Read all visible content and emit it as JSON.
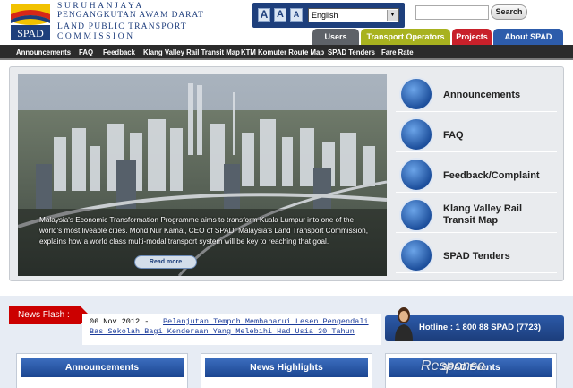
{
  "logo": {
    "acronym": "SPAD",
    "line1": "SURUHANJAYA",
    "line2": "PENGANGKUTAN AWAM DARAT",
    "line3": "LAND PUBLIC TRANSPORT",
    "line4": "COMMISSION"
  },
  "utility": {
    "font_buttons": [
      "A",
      "A",
      "A"
    ],
    "language": "English",
    "search_button": "Search"
  },
  "tabs": [
    {
      "label": "Users",
      "color": "#5e6268"
    },
    {
      "label": "Transport Operators",
      "color": "#a8b21f"
    },
    {
      "label": "Projects",
      "color": "#c8202a"
    },
    {
      "label": "About SPAD",
      "color": "#2d5cab"
    }
  ],
  "nav": [
    "Announcements",
    "FAQ",
    "Feedback",
    "Klang Valley Rail Transit Map",
    "KTM Komuter Route Map",
    "SPAD Tenders",
    "Fare Rate"
  ],
  "hero": {
    "caption": "Malaysia's Economic Transformation Programme aims to transform  Kuala Lumpur into one of the world's most liveable cities.  Mohd Nur Kamal, CEO of SPAD, Malaysia's Land Transport Commission, explains how a world class multi-modal transport system will be key to reaching that goal.",
    "more_button": "Read more"
  },
  "quick_links": [
    {
      "label": "Announcements",
      "icon": "megaphone-icon"
    },
    {
      "label": "FAQ",
      "icon": "question-icon"
    },
    {
      "label": "Feedback/Complaint",
      "icon": "feedback-form-icon"
    },
    {
      "label": "Klang Valley Rail Transit Map",
      "icon": "rail-map-icon"
    },
    {
      "label": "SPAD Tenders",
      "icon": "tender-documents-icon"
    }
  ],
  "news_flash": {
    "badge": "News Flash :",
    "date": "06 Nov 2012 -",
    "headline": "Pelanjutan Tempoh Membaharui Lesen Pengendali Bas Sekolah Bagi Kenderaan Yang Melebihi Had Usia 30 Tahun"
  },
  "hotline": "Hotline : 1 800 88 SPAD (7723)",
  "panels": [
    "Announcements",
    "News Highlights",
    "SPAD Events"
  ],
  "watermark": "Response."
}
